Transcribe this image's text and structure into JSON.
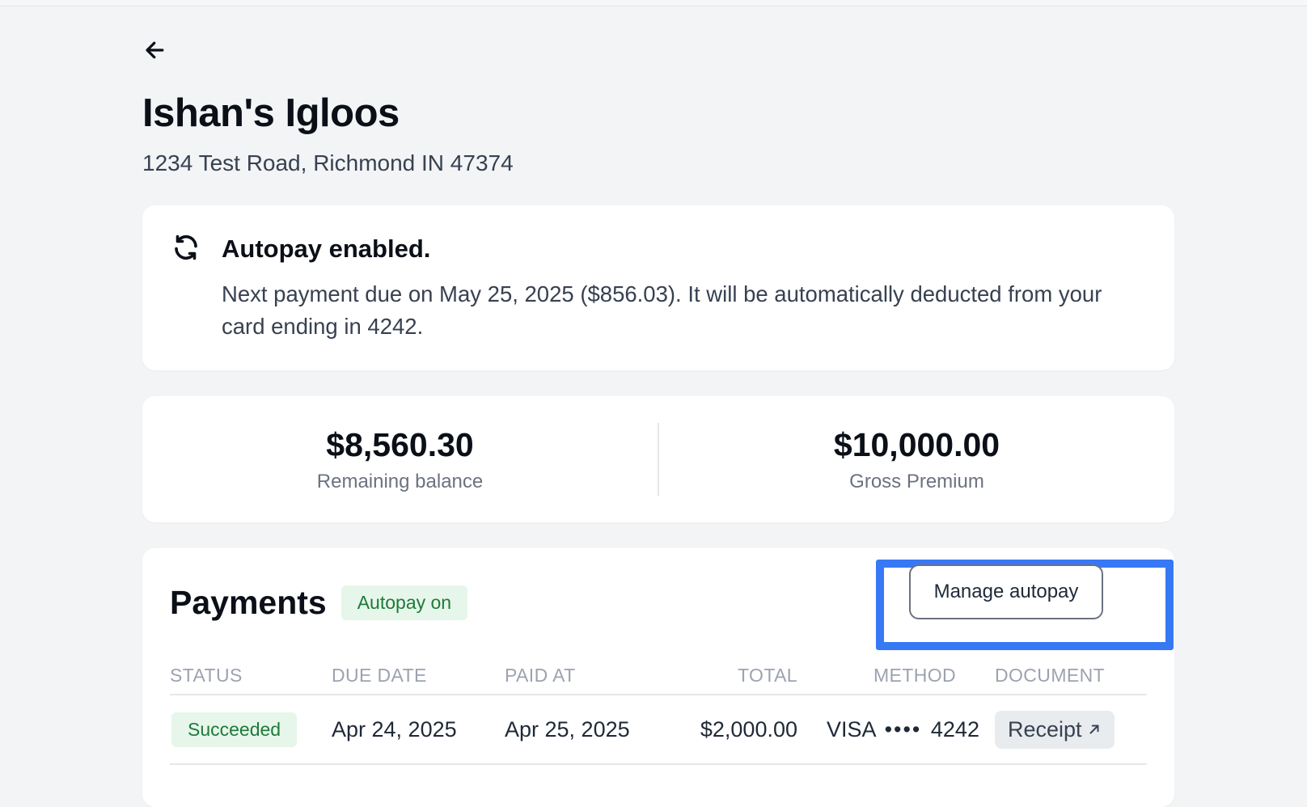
{
  "header": {
    "title": "Ishan's Igloos",
    "address": "1234 Test Road, Richmond IN 47374"
  },
  "autopay_notice": {
    "title": "Autopay enabled.",
    "description": "Next payment due on May 25, 2025 ($856.03). It will be automatically deducted from your card ending in 4242."
  },
  "summary": {
    "remaining_balance_value": "$8,560.30",
    "remaining_balance_label": "Remaining balance",
    "gross_premium_value": "$10,000.00",
    "gross_premium_label": "Gross Premium"
  },
  "payments": {
    "title": "Payments",
    "badge": "Autopay on",
    "manage_label": "Manage autopay",
    "columns": [
      "STATUS",
      "DUE DATE",
      "PAID AT",
      "TOTAL",
      "METHOD",
      "DOCUMENT"
    ],
    "rows": [
      {
        "status": "Succeeded",
        "due_date": "Apr 24, 2025",
        "paid_at": "Apr 25, 2025",
        "total": "$2,000.00",
        "method_brand": "VISA",
        "method_dots": "••••",
        "method_last4": "4242",
        "document": "Receipt"
      }
    ]
  },
  "colors": {
    "accent_highlight": "#3778f5",
    "success_bg": "#e6f6ea",
    "success_text": "#1f7a3a"
  }
}
